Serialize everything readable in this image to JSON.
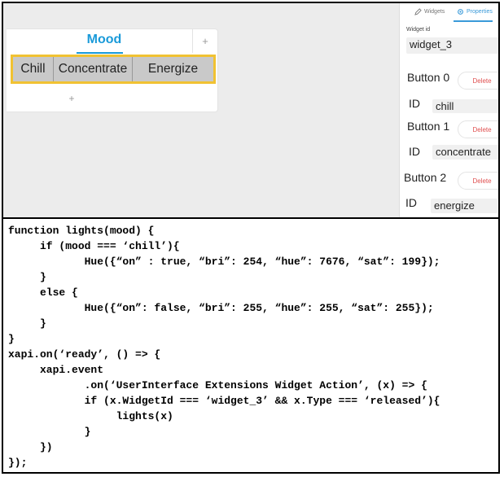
{
  "card": {
    "title": "Mood",
    "add_top": "+",
    "add_bottom": "+",
    "buttons": [
      "Chill",
      "Concentrate",
      "Energize"
    ]
  },
  "panel": {
    "tabs": {
      "widgets": "Widgets",
      "properties": "Properties"
    },
    "widget_id_label": "Widget id",
    "widget_id_value": "widget_3",
    "buttons": [
      {
        "label": "Button 0",
        "id_label": "ID",
        "id_value": "chill",
        "delete": "Delete"
      },
      {
        "label": "Button 1",
        "id_label": "ID",
        "id_value": "concentrate",
        "delete": "Delete"
      },
      {
        "label": "Button  2",
        "id_label": "ID",
        "id_value": "energize",
        "delete": "Delete"
      }
    ]
  },
  "code": [
    "function lights(mood) {",
    "     if (mood === ‘chill’){",
    "            Hue({“on” : true, “bri”: 254, “hue”: 7676, “sat”: 199});",
    "     }",
    "     else {",
    "            Hue({“on”: false, “bri”: 255, “hue”: 255, “sat”: 255});",
    "     }",
    "}",
    "xapi.on(‘ready’, () => {",
    "     xapi.event",
    "            .on(‘UserInterface Extensions Widget Action’, (x) => {",
    "            if (x.WidgetId === ‘widget_3’ && x.Type === ‘released’){",
    "                 lights(x)",
    "            }",
    "     })",
    "});"
  ],
  "colors": {
    "accent": "#1a9ad9",
    "highlight": "#f1c232",
    "delete": "#e05050"
  },
  "icons": {
    "widgets_tab": "pencil-icon",
    "properties_tab": "gear-icon"
  }
}
